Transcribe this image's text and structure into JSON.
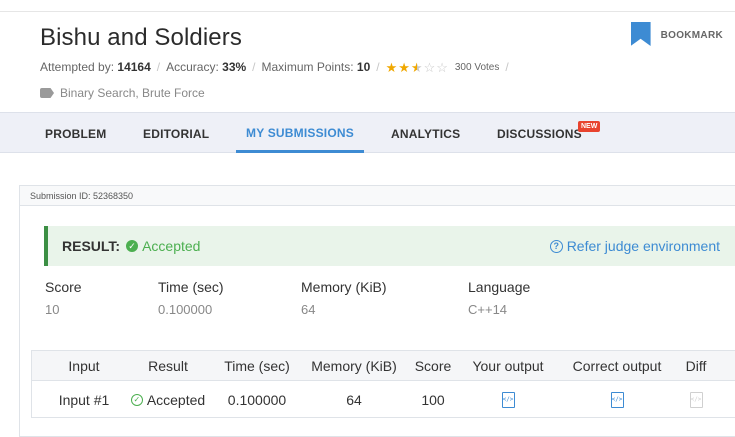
{
  "problem": {
    "title": "Bishu and Soldiers",
    "attempted_label": "Attempted by:",
    "attempted_value": "14164",
    "accuracy_label": "Accuracy:",
    "accuracy_value": "33%",
    "points_label": "Maximum Points:",
    "points_value": "10",
    "rating": 2.5,
    "rating_max": 5,
    "votes": "300 Votes",
    "tags": "Binary Search, Brute Force",
    "bookmark_label": "BOOKMARK"
  },
  "tabs": [
    {
      "label": "PROBLEM"
    },
    {
      "label": "EDITORIAL"
    },
    {
      "label": "MY SUBMISSIONS"
    },
    {
      "label": "ANALYTICS"
    },
    {
      "label": "DISCUSSIONS"
    }
  ],
  "new_badge": "NEW",
  "submission": {
    "id_label": "Submission ID: 52368350",
    "result_label": "RESULT:",
    "result_value": "Accepted",
    "refer_label": "Refer judge environment",
    "stats": [
      {
        "label": "Score",
        "value": "10"
      },
      {
        "label": "Time (sec)",
        "value": "0.100000"
      },
      {
        "label": "Memory (KiB)",
        "value": "64"
      },
      {
        "label": "Language",
        "value": "C++14"
      }
    ],
    "table": {
      "headers": [
        "Input",
        "Result",
        "Time (sec)",
        "Memory (KiB)",
        "Score",
        "Your output",
        "Correct output",
        "Diff"
      ],
      "row": {
        "input": "Input #1",
        "result": "Accepted",
        "time": "0.100000",
        "memory": "64",
        "score": "100"
      }
    }
  },
  "colors": {
    "accent": "#3d8bd3",
    "success": "#4caf50",
    "result_bg": "#e9f4ea",
    "star": "#f0a800",
    "new_badge": "#e8432e"
  }
}
